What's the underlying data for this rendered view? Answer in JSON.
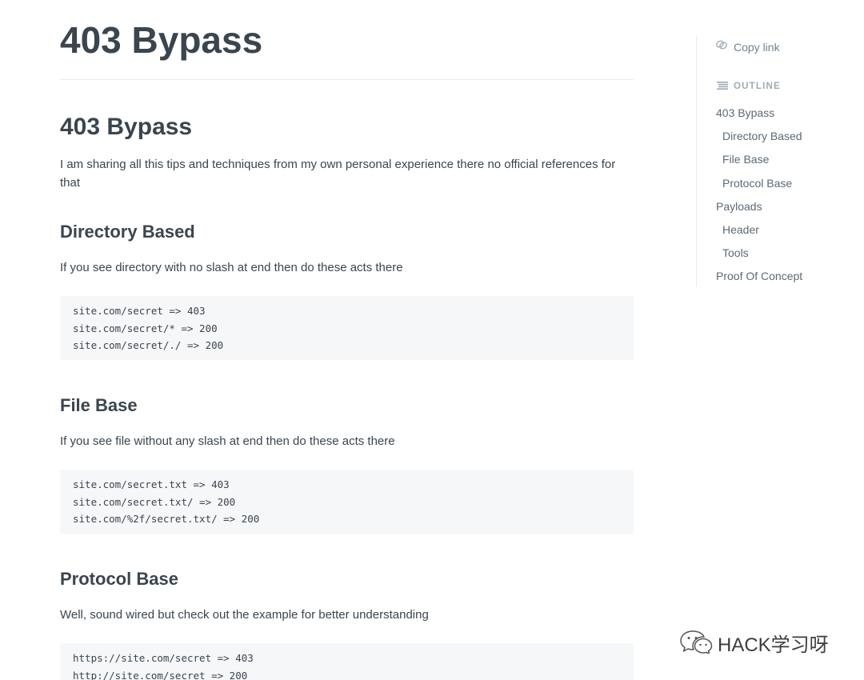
{
  "page_title": "403 Bypass",
  "sections": {
    "intro": {
      "heading": "403 Bypass",
      "text": "I am sharing all this tips and techniques from my own personal experience there no official references for that"
    },
    "directory": {
      "heading": "Directory Based",
      "text": "If you see directory with no slash at end then do these acts there",
      "code": [
        "site.com/secret => 403",
        "site.com/secret/* => 200",
        "site.com/secret/./ => 200"
      ]
    },
    "file": {
      "heading": "File Base",
      "text": "If you see file without any slash at end then do these acts there",
      "code": [
        "site.com/secret.txt => 403",
        "site.com/secret.txt/ => 200",
        "site.com/%2f/secret.txt/ => 200"
      ]
    },
    "protocol": {
      "heading": "Protocol Base",
      "text": "Well, sound wired but check out the example for better understanding",
      "code": [
        "https://site.com/secret => 403",
        "http://site.com/secret => 200"
      ]
    }
  },
  "sidebar": {
    "copy_link": "Copy link",
    "copy_link_icon": "link-icon",
    "outline_label": "OUTLINE",
    "outline_icon": "outline-list-icon",
    "outline": [
      "403 Bypass",
      "Directory Based",
      "File Base",
      "Protocol Base",
      "Payloads",
      "Header",
      "Tools",
      "Proof Of Concept"
    ]
  },
  "watermark": {
    "icon": "wechat-icon",
    "text": "HACK学习呀"
  },
  "colors": {
    "text": "#3b454e",
    "muted": "#74818d",
    "code_bg": "#f5f7f9",
    "divider": "#e6ecf1"
  }
}
